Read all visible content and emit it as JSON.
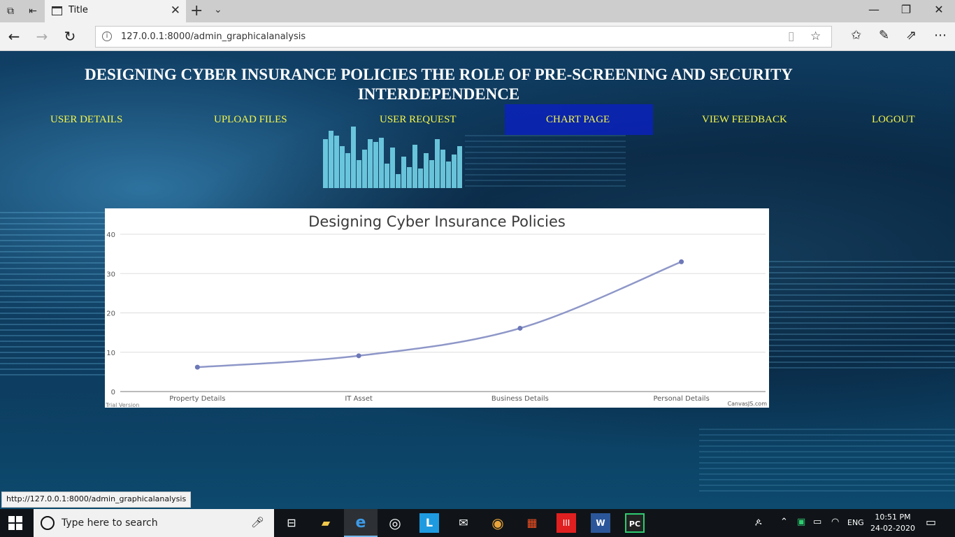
{
  "browser": {
    "tab_title": "Title",
    "url": "127.0.0.1:8000/admin_graphicalanalysis",
    "status_url": "http://127.0.0.1:8000/admin_graphicalanalysis"
  },
  "page": {
    "heading": "DESIGNING CYBER INSURANCE POLICIES THE ROLE OF PRE-SCREENING AND SECURITY INTERDEPENDENCE",
    "nav": [
      {
        "label": "USER DETAILS"
      },
      {
        "label": "UPLOAD FILES"
      },
      {
        "label": "USER REQUEST"
      },
      {
        "label": "CHART PAGE",
        "active": true
      },
      {
        "label": "VIEW FEEDBACK"
      },
      {
        "label": "LOGOUT"
      }
    ],
    "nav_color": "#f5f54a"
  },
  "chart_data": {
    "type": "line",
    "title": "Designing Cyber Insurance Policies",
    "categories": [
      "Property Details",
      "IT Asset",
      "Business Details",
      "Personal Details"
    ],
    "values": [
      6.2,
      9.1,
      16.1,
      33
    ],
    "ylim": [
      0,
      40
    ],
    "yticks": [
      0,
      10,
      20,
      30,
      40
    ],
    "grid": true,
    "line_color": "#8e97c8",
    "marker_color": "#6c78b8",
    "watermark_left": "Trial Version",
    "watermark_right": "CanvasJS.com"
  },
  "taskbar": {
    "search_placeholder": "Type here to search",
    "lang": "ENG",
    "time": "10:51 PM",
    "date": "24-02-2020"
  }
}
